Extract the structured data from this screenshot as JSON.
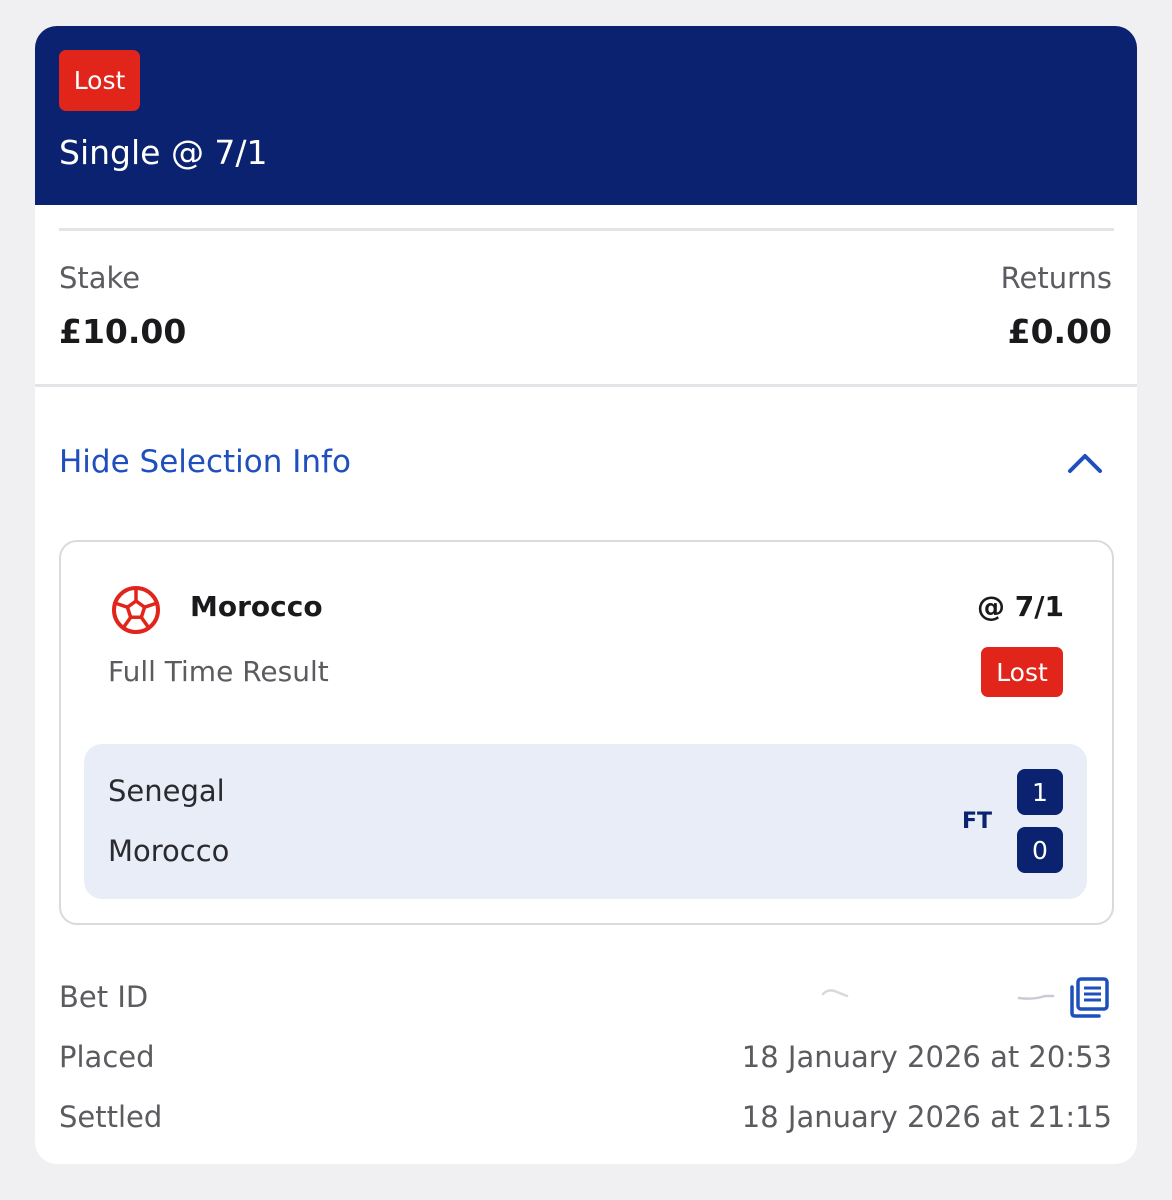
{
  "header": {
    "status": "Lost",
    "title": "Single @ 7/1",
    "background_color": "#0a2270",
    "status_color": "#e1251b"
  },
  "summary": {
    "stake_label": "Stake",
    "stake_value": "£10.00",
    "returns_label": "Returns",
    "returns_value": "£0.00"
  },
  "toggle": {
    "label": "Hide Selection Info",
    "icon": "chevron-up-icon",
    "link_color": "#1f4fbd"
  },
  "selection": {
    "sport_icon": "football-icon",
    "name": "Morocco",
    "odds": "@ 7/1",
    "market": "Full Time Result",
    "status": "Lost",
    "event": {
      "home_team": "Senegal",
      "away_team": "Morocco",
      "period": "FT",
      "home_score": "1",
      "away_score": "0"
    }
  },
  "details": {
    "bet_id_label": "Bet ID",
    "bet_id_copy_icon": "copy-icon",
    "placed_label": "Placed",
    "placed_value": "18 January 2026 at 20:53",
    "settled_label": "Settled",
    "settled_value": "18 January 2026 at 21:15"
  }
}
